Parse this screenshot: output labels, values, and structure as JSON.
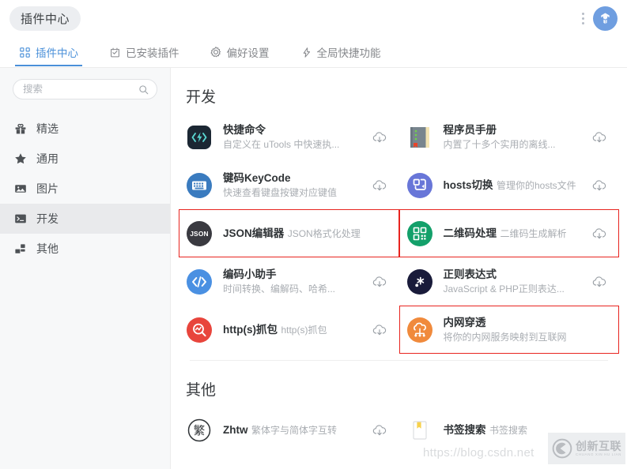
{
  "window": {
    "app_pill_label": "插件中心",
    "brand_icon": "utools-logo-icon",
    "menu_icon": "more-vertical-icon"
  },
  "tabs": [
    {
      "label": "插件中心",
      "icon": "grid-apps-icon",
      "active": true
    },
    {
      "label": "已安装插件",
      "icon": "checklist-box-icon",
      "active": false
    },
    {
      "label": "偏好设置",
      "icon": "gear-icon",
      "active": false
    },
    {
      "label": "全局快捷功能",
      "icon": "lightning-bolt-icon",
      "active": false
    }
  ],
  "sidebar": {
    "search": {
      "value": "",
      "placeholder": "搜索",
      "icon": "search-icon"
    },
    "items": [
      {
        "label": "精选",
        "icon": "gift-icon",
        "active": false
      },
      {
        "label": "通用",
        "icon": "star-icon",
        "active": false
      },
      {
        "label": "图片",
        "icon": "image-icon",
        "active": false
      },
      {
        "label": "开发",
        "icon": "terminal-icon",
        "active": true
      },
      {
        "label": "其他",
        "icon": "blocks-icon",
        "active": false
      }
    ]
  },
  "sections": [
    {
      "title": "开发",
      "cards": [
        {
          "name": "快捷命令",
          "desc": "自定义在 uTools 中快速执...",
          "icon": "code-bolt-icon",
          "download_icon": "cloud-download-icon",
          "has_download": true,
          "highlighted": false,
          "icon_bg": "#1b2733",
          "icon_fg": "#5ad7d2"
        },
        {
          "name": "程序员手册",
          "desc": "内置了十多个实用的离线...",
          "icon": "book-manual-icon",
          "download_icon": "cloud-download-icon",
          "has_download": true,
          "highlighted": false,
          "icon_bg": "#78858e",
          "icon_fg": "#f3e4b4"
        },
        {
          "name": "键码KeyCode",
          "desc": "快速查看键盘按键对应键值",
          "icon": "keyboard-icon",
          "download_icon": "cloud-download-icon",
          "has_download": true,
          "highlighted": false,
          "icon_bg": "#3a7bbf",
          "icon_fg": "#ffffff"
        },
        {
          "name": "hosts切换",
          "desc": "管理你的hosts文件",
          "icon": "hosts-switch-icon",
          "download_icon": "cloud-download-icon",
          "has_download": true,
          "highlighted": false,
          "icon_bg": "#6876d8",
          "icon_fg": "#ffffff"
        },
        {
          "name": "JSON编辑器",
          "desc": "JSON格式化处理",
          "icon": "json-icon",
          "download_icon": "cloud-download-icon",
          "has_download": false,
          "highlighted": true,
          "icon_bg": "#3a3a40",
          "icon_fg": "#ffffff"
        },
        {
          "name": "二维码处理",
          "desc": "二维码生成解析",
          "icon": "qrcode-icon",
          "download_icon": "cloud-download-icon",
          "has_download": true,
          "highlighted": true,
          "icon_bg": "#13a06a",
          "icon_fg": "#ffffff"
        },
        {
          "name": "编码小助手",
          "desc": "时间转换、编解码、哈希...",
          "icon": "code-brackets-icon",
          "download_icon": "cloud-download-icon",
          "has_download": true,
          "highlighted": false,
          "icon_bg": "#4a90e2",
          "icon_fg": "#ffffff"
        },
        {
          "name": "正则表达式",
          "desc": "JavaScript & PHP正则表达...",
          "icon": "regex-star-icon",
          "download_icon": "cloud-download-icon",
          "has_download": true,
          "highlighted": false,
          "icon_bg": "#191b3a",
          "icon_fg": "#ffffff"
        },
        {
          "name": "http(s)抓包",
          "desc": "http(s)抓包",
          "icon": "packet-capture-icon",
          "download_icon": "cloud-download-icon",
          "has_download": true,
          "highlighted": false,
          "icon_bg": "#e8453c",
          "icon_fg": "#ffffff"
        },
        {
          "name": "内网穿透",
          "desc": "将你的内网服务映射到互联网",
          "icon": "network-tunnel-icon",
          "download_icon": "cloud-download-icon",
          "has_download": false,
          "highlighted": true,
          "icon_bg": "#f08a3c",
          "icon_fg": "#ffffff"
        }
      ]
    },
    {
      "title": "其他",
      "cards": [
        {
          "name": "Zhtw",
          "desc": "繁体字与简体字互转",
          "icon": "traditional-chinese-icon",
          "download_icon": "cloud-download-icon",
          "has_download": true,
          "highlighted": false,
          "icon_bg": "#ffffff",
          "icon_fg": "#2f3336"
        },
        {
          "name": "书签搜索",
          "desc": "书签搜索",
          "icon": "bookmark-icon",
          "download_icon": "cloud-download-icon",
          "has_download": false,
          "highlighted": false,
          "icon_bg": "#ffffff",
          "icon_fg": "#f7d14c"
        }
      ]
    }
  ],
  "watermarks": {
    "url_text": "https://blog.csdn.net",
    "brand_cn": "创新互联",
    "brand_en": "CHUANG XIN HU LIAN"
  },
  "colors": {
    "accent": "#4a90d9",
    "highlight": "#e8241f",
    "sidebar_bg": "#f7f8f9",
    "text_primary": "#2f3336",
    "text_muted": "#a9adb2"
  }
}
